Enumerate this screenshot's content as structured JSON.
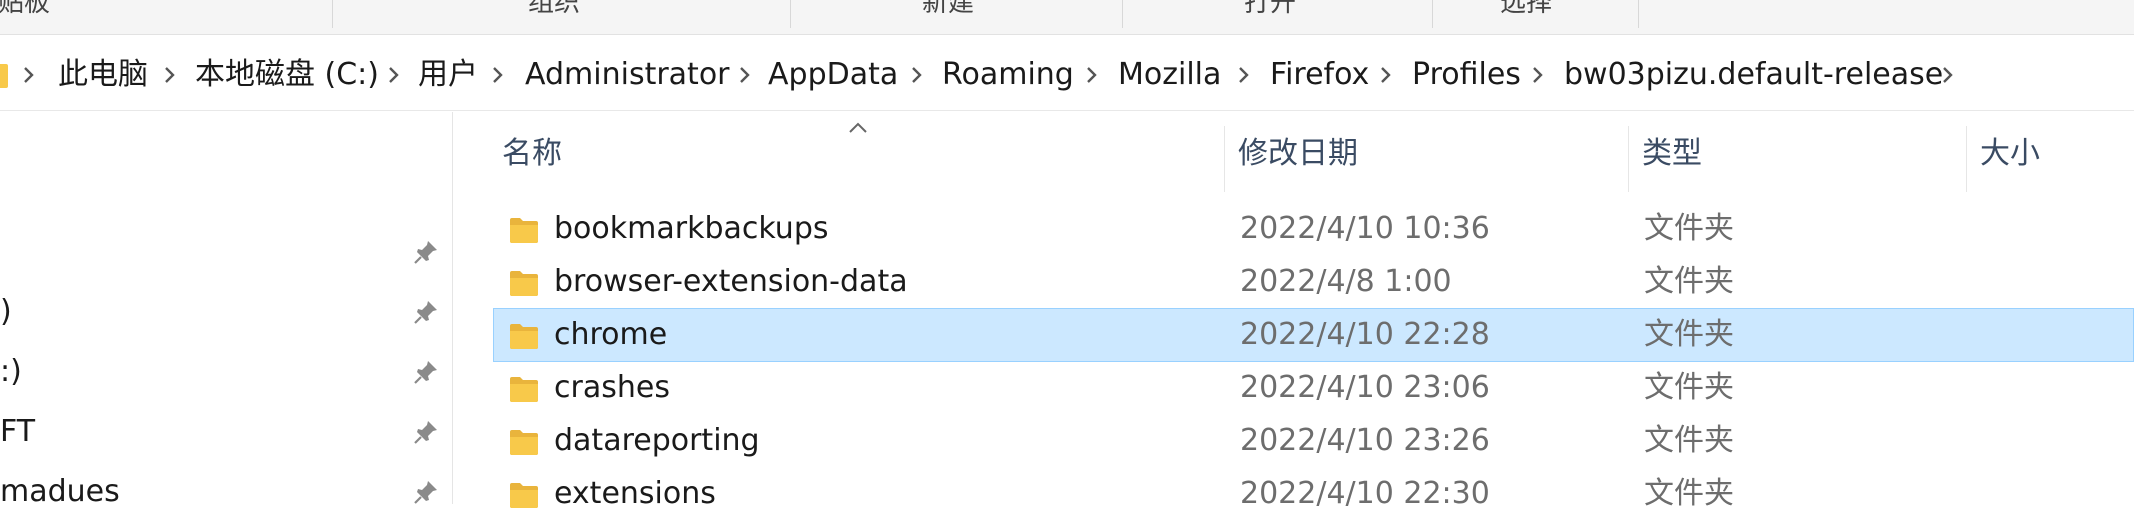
{
  "ribbon": {
    "groups": [
      "剪贴板",
      "组织",
      "新建",
      "打开",
      "选择"
    ]
  },
  "address_bar": {
    "crumbs": [
      "此电脑",
      "本地磁盘 (C:)",
      "用户",
      "Administrator",
      "AppData",
      "Roaming",
      "Mozilla",
      "Firefox",
      "Profiles",
      "bw03pizu.default-release"
    ]
  },
  "nav": {
    "items": [
      {
        "label": ""
      },
      {
        "label": ")"
      },
      {
        "label": ":)"
      },
      {
        "label": "FT"
      },
      {
        "label": "madues"
      }
    ]
  },
  "columns": {
    "name": "名称",
    "date": "修改日期",
    "type": "类型",
    "size": "大小"
  },
  "files": [
    {
      "name": "bookmarkbackups",
      "date": "2022/4/10 10:36",
      "type": "文件夹"
    },
    {
      "name": "browser-extension-data",
      "date": "2022/4/8 1:00",
      "type": "文件夹"
    },
    {
      "name": "chrome",
      "date": "2022/4/10 22:28",
      "type": "文件夹",
      "selected": true
    },
    {
      "name": "crashes",
      "date": "2022/4/10 23:06",
      "type": "文件夹"
    },
    {
      "name": "datareporting",
      "date": "2022/4/10 23:26",
      "type": "文件夹"
    },
    {
      "name": "extensions",
      "date": "2022/4/10 22:30",
      "type": "文件夹"
    }
  ],
  "icons": {
    "folder": "folder-icon",
    "pin": "pin-icon",
    "chevron": "chevron-right-icon",
    "sort": "sort-ascending-icon"
  },
  "colors": {
    "selection_bg": "#cce8ff",
    "selection_border": "#99d1ff",
    "folder_yellow": "#f8c94a"
  }
}
